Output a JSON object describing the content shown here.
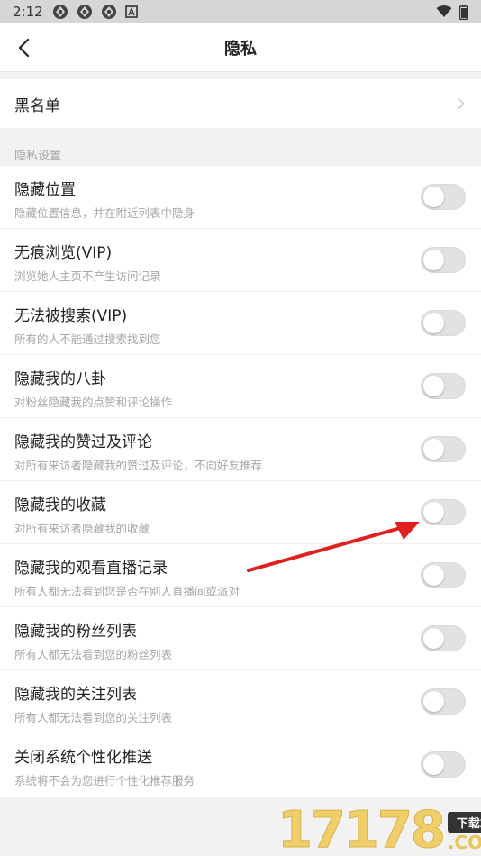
{
  "status_bar": {
    "time": "2:12",
    "notification_icons": [
      "app-notification-icon",
      "app-notification-icon",
      "app-notification-icon",
      "a-box-icon"
    ],
    "right_icons": [
      "wifi-icon",
      "battery-icon"
    ]
  },
  "header": {
    "title": "隐私",
    "back_icon": "chevron-left-icon"
  },
  "blacklist": {
    "label": "黑名单",
    "chevron_icon": "chevron-right-icon"
  },
  "section": {
    "title": "隐私设置"
  },
  "settings": [
    {
      "title": "隐藏位置",
      "desc": "隐藏位置信息，并在附近列表中隐身",
      "enabled": false
    },
    {
      "title": "无痕浏览(VIP)",
      "desc": "浏览她人主页不产生访问记录",
      "enabled": false
    },
    {
      "title": "无法被搜索(VIP)",
      "desc": "所有的人不能通过搜索找到您",
      "enabled": false
    },
    {
      "title": "隐藏我的八卦",
      "desc": "对粉丝隐藏我的点赞和评论操作",
      "enabled": false
    },
    {
      "title": "隐藏我的赞过及评论",
      "desc": "对所有来访者隐藏我的赞过及评论，不向好友推荐",
      "enabled": false
    },
    {
      "title": "隐藏我的收藏",
      "desc": "对所有来访者隐藏我的收藏",
      "enabled": false
    },
    {
      "title": "隐藏我的观看直播记录",
      "desc": "所有人都无法看到您是否在别人直播间或派对",
      "enabled": false
    },
    {
      "title": "隐藏我的粉丝列表",
      "desc": "所有人都无法看到您的粉丝列表",
      "enabled": false
    },
    {
      "title": "隐藏我的关注列表",
      "desc": "所有人都无法看到您的关注列表",
      "enabled": false
    },
    {
      "title": "关闭系统个性化推送",
      "desc": "系统将不会为您进行个性化推荐服务",
      "enabled": false
    }
  ],
  "watermark": {
    "digits": "17178",
    "badge": "下载站",
    "suffix": ".COM"
  },
  "colors": {
    "annotation_arrow": "#e02020",
    "toggle_off": "#e2e2e2",
    "watermark_gold": "#f0cf6a"
  }
}
